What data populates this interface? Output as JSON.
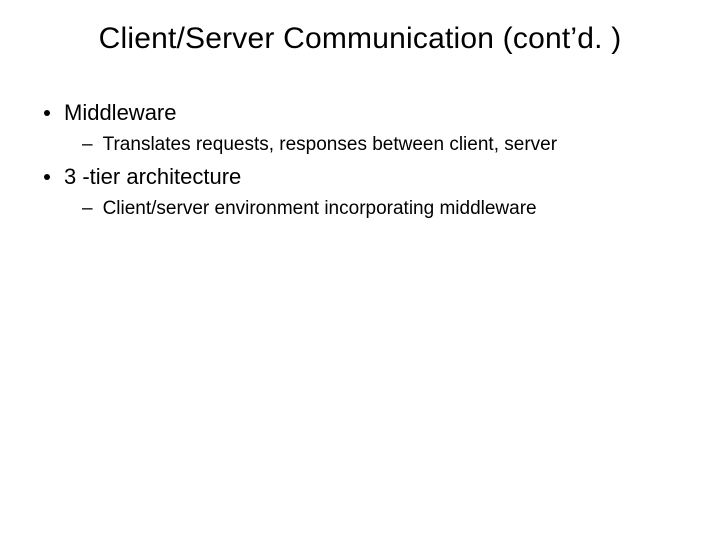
{
  "slide": {
    "title": "Client/Server Communication (cont’d. )",
    "items": [
      {
        "text": "Middleware",
        "sub": [
          "Translates requests, responses between client, server"
        ]
      },
      {
        "text": "3 -tier architecture",
        "sub": [
          "Client/server environment incorporating middleware"
        ]
      }
    ]
  }
}
